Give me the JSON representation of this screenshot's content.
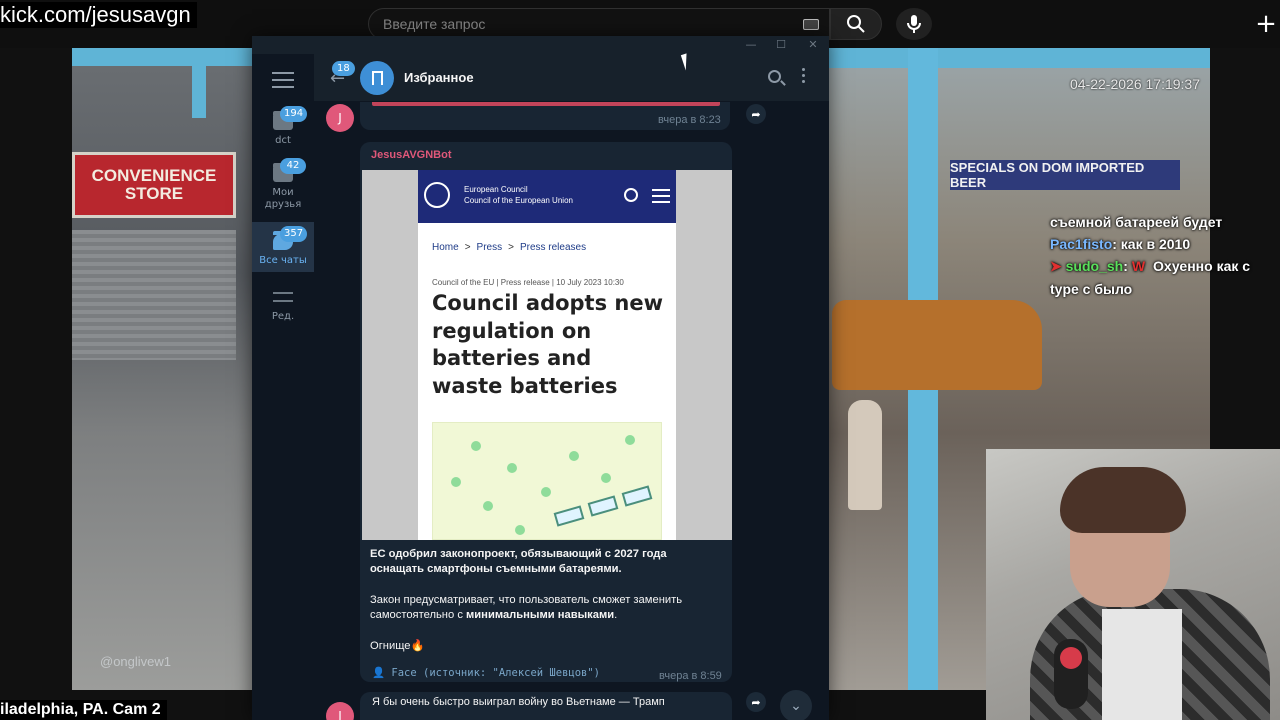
{
  "browser": {
    "url_text": "kick.com/jesusavgn",
    "search_placeholder": "Введите запрос",
    "plus_label": "+"
  },
  "stream": {
    "timestamp": "04-22-2026 17:19:37",
    "store_sign_line1": "CONVENIENCE",
    "store_sign_line2": "STORE",
    "banner": "SPECIALS ON DOM IMPORTED BEER",
    "watermark": "@onglivew1",
    "caption": "iladelphia, PA. Cam 2"
  },
  "telegram": {
    "window_controls": [
      "—",
      "☐",
      "✕"
    ],
    "folders": [
      {
        "label": "dct",
        "badge": "194",
        "active": false
      },
      {
        "label": "Мои друзья",
        "badge": "42",
        "active": false
      },
      {
        "label": "Все чаты",
        "badge": "357",
        "active": true
      },
      {
        "label": "Ред.",
        "badge": "",
        "active": false
      }
    ],
    "header": {
      "back_badge": "18",
      "title": "Избранное"
    },
    "prev_message_time": "вчера в 8:23",
    "avatar_letter": "J",
    "message": {
      "sender": "JesusAVGNBot",
      "preview": {
        "org_line1": "European Council",
        "org_line2": "Council of the European Union",
        "crumbs": [
          "Home",
          "Press",
          "Press releases"
        ],
        "meta": "Council of the EU | Press release | 10 July 2023 10:30",
        "headline": "Council adopts new regulation on batteries and waste batteries"
      },
      "para1": "ЕС одобрил законопроект, обязывающий с 2027 года оснащать смартфоны съемными батареями.",
      "para2_a": "Закон предусматривает, что пользователь сможет заменить самостоятельно с ",
      "para2_b": "минимальными навыками",
      "para2_c": ".",
      "para3": "Огнище🔥",
      "signature": "👤 Face (источник: \"Алексей Шевцов\")",
      "time": "вчера в 8:59"
    },
    "next_message": "Я бы очень быстро выиграл войну во Вьетнаме — Трамп"
  },
  "chat_overlay": [
    {
      "user": "",
      "text": "съемной батареей будет",
      "user_color": "#ffffff",
      "badge": false
    },
    {
      "user": "Pac1fisto",
      "text": ": как в 2010",
      "user_color": "#7ab8ff",
      "badge": false
    },
    {
      "user": "sudo_sh",
      "text": ":",
      "user_color": "#59e05b",
      "badge": true,
      "badge_text": "W",
      "after": " Охуенно как с"
    },
    {
      "user": "",
      "text": "type с было",
      "user_color": "#ffffff",
      "badge": false
    }
  ]
}
